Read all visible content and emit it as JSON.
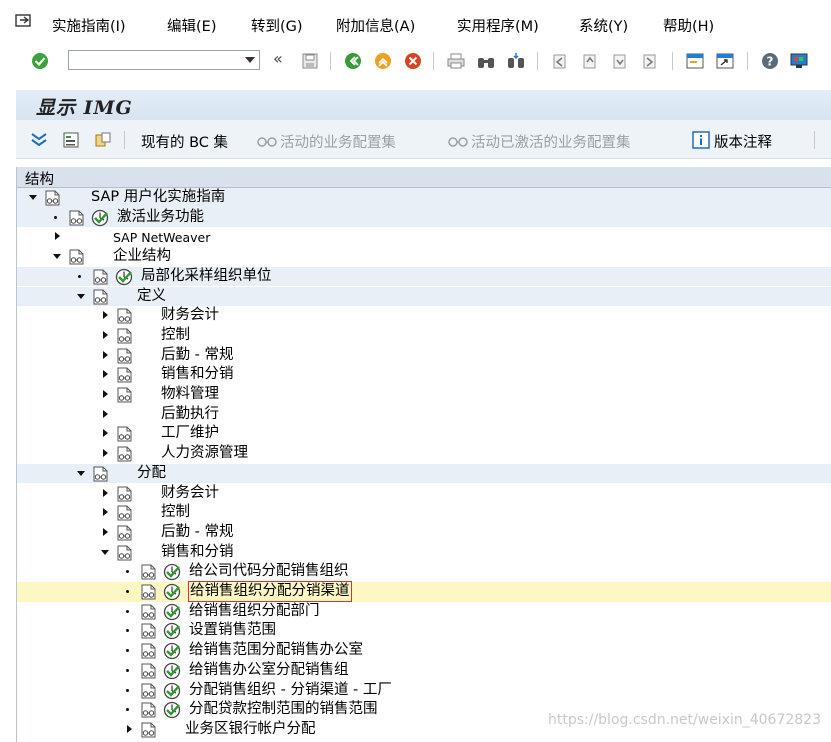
{
  "menu": {
    "items": [
      {
        "label": "实施指南(I)"
      },
      {
        "label": "编辑(E)"
      },
      {
        "label": "转到(G)"
      },
      {
        "label": "附加信息(A)"
      },
      {
        "label": "实用程序(M)"
      },
      {
        "label": "系统(Y)"
      },
      {
        "label": "帮助(H)"
      }
    ]
  },
  "toolbar": {
    "command_value": "",
    "back_label": "«"
  },
  "screen": {
    "title": "显示 IMG"
  },
  "app_toolbar": {
    "current_bc_set": "现有的 BC 集",
    "active_bc_set": "活动的业务配置集",
    "activated_bc_set": "活动已激活的业务配置集",
    "release_notes": "版本注释"
  },
  "tree": {
    "header": "结构",
    "rows": [
      {
        "label": "SAP 用户化实施指南"
      },
      {
        "label": "激活业务功能"
      },
      {
        "label": "SAP NetWeaver"
      },
      {
        "label": "企业结构"
      },
      {
        "label": "局部化采样组织单位"
      },
      {
        "label": "定义"
      },
      {
        "label": "财务会计"
      },
      {
        "label": "控制"
      },
      {
        "label": "后勤 - 常规"
      },
      {
        "label": "销售和分销"
      },
      {
        "label": "物料管理"
      },
      {
        "label": "后勤执行"
      },
      {
        "label": "工厂维护"
      },
      {
        "label": "人力资源管理"
      },
      {
        "label": "分配"
      },
      {
        "label": "财务会计"
      },
      {
        "label": "控制"
      },
      {
        "label": "后勤 - 常规"
      },
      {
        "label": "销售和分销"
      },
      {
        "label": "给公司代码分配销售组织"
      },
      {
        "label": "给销售组织分配分销渠道"
      },
      {
        "label": "给销售组织分配部门"
      },
      {
        "label": "设置销售范围"
      },
      {
        "label": "给销售范围分配销售办公室"
      },
      {
        "label": "给销售办公室分配销售组"
      },
      {
        "label": "分配销售组织 - 分销渠道 - 工厂"
      },
      {
        "label": "分配贷款控制范围的销售范围"
      },
      {
        "label": "业务区银行帐户分配"
      }
    ]
  },
  "watermark": "https://blog.csdn.net/weixin_40672823",
  "colors": {
    "accent": "#1f7fd6",
    "selected_row": "#fdf7c4",
    "alt_row": "#e8eff6",
    "selection_border": "#e03030"
  }
}
